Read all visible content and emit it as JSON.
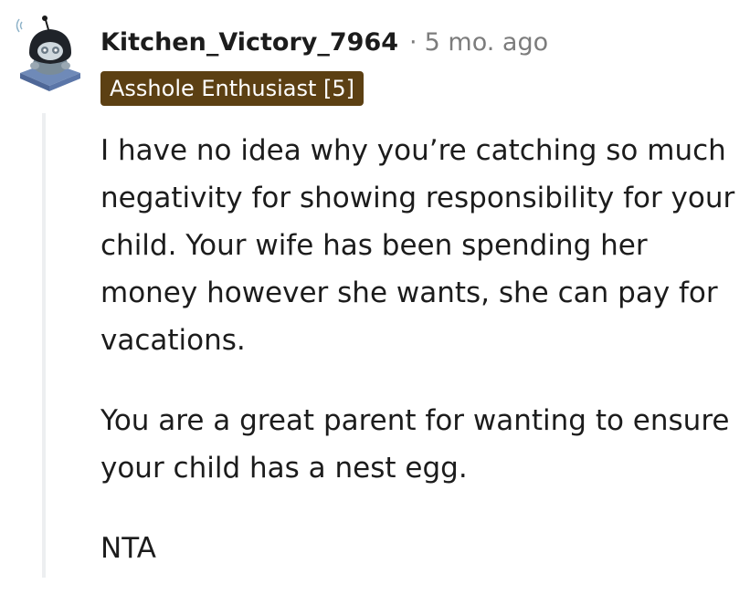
{
  "comment": {
    "username": "Kitchen_Victory_7964",
    "separator": "·",
    "age": "5 mo. ago",
    "flair": "Asshole Enthusiast [5]",
    "paragraphs": [
      "I have no idea why you’re catching so much negativity for showing responsibility for your child. Your wife has been spending her money however she wants, she can pay for vacations.",
      "You are a great parent for wanting to ensure your child has a nest egg.",
      "NTA"
    ]
  },
  "colors": {
    "flair_background": "#5c4013",
    "flair_text": "#ffffff",
    "meta_gray": "#7c7c7c",
    "thread_line": "#edeff1",
    "text": "#1c1c1c"
  },
  "icons": {
    "avatar": "snoo-avatar-icon"
  }
}
